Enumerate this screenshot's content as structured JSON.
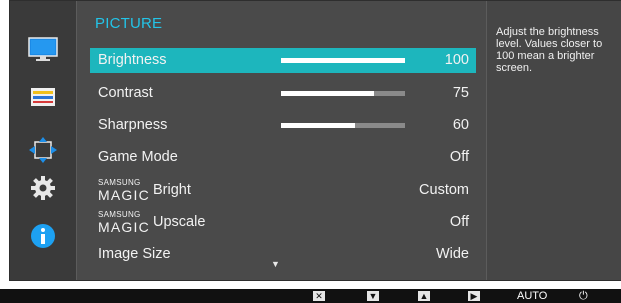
{
  "menu": {
    "title": "PICTURE",
    "rows": [
      {
        "label": "Brightness",
        "value": "100",
        "level": 1.0
      },
      {
        "label": "Contrast",
        "value": "75",
        "level": 0.75
      },
      {
        "label": "Sharpness",
        "value": "60",
        "level": 0.6
      },
      {
        "label": "Game Mode",
        "value": "Off"
      },
      {
        "brand_small": "SAMSUNG",
        "brand_big": "MAGIC",
        "label": "Bright",
        "value": "Custom"
      },
      {
        "brand_small": "SAMSUNG",
        "brand_big": "MAGIC",
        "label": "Upscale",
        "value": "Off"
      },
      {
        "label": "Image Size",
        "value": "Wide"
      }
    ],
    "more_icon": "down-arrow-icon"
  },
  "sidebar": {
    "icons": [
      "monitor-icon",
      "color-bars-icon",
      "position-arrows-icon",
      "gear-icon",
      "info-icon"
    ]
  },
  "description": "Adjust the brightness level. Values closer to 100 mean a brighter screen.",
  "buttons": {
    "close_icon": "close-icon",
    "down_icon": "down-icon",
    "up_icon": "up-icon",
    "enter_icon": "enter-icon",
    "auto_label": "AUTO",
    "power_icon": "power-icon"
  },
  "colors": {
    "accent": "#23c4e8",
    "highlight": "#1db6bd",
    "info": "#1da1f2"
  }
}
